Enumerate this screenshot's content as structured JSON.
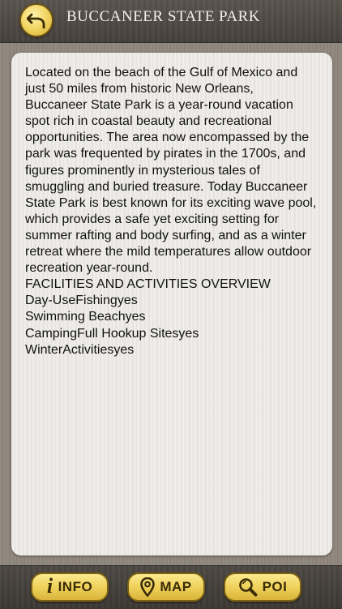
{
  "header": {
    "title": "BUCCANEER STATE PARK",
    "back_icon": "back-arrow-icon"
  },
  "content": {
    "description": "Located on the beach of the Gulf of Mexico and just 50 miles from historic New Orleans, Buccaneer State Park is a year-round vacation spot rich in coastal beauty and recreational opportunities. The area now encompassed by the park was frequented by pirates in the 1700s, and figures prominently in mysterious tales of smuggling and buried treasure. Today Buccaneer State Park is best known for its exciting wave pool, which provides a safe yet exciting setting for summer rafting and body surfing, and as a winter retreat where the mild temperatures allow outdoor recreation year-round.\nFACILITIES AND ACTIVITIES OVERVIEW\nDay-UseFishingyes\n Swimming Beachyes\nCampingFull Hookup Sitesyes\nWinterActivitiesyes"
  },
  "footer": {
    "info_label": "INFO",
    "info_glyph": "i",
    "map_label": "MAP",
    "poi_label": "POI"
  },
  "colors": {
    "accent": "#f1d45f",
    "bar": "#45403b",
    "card": "#ebe9e4"
  }
}
